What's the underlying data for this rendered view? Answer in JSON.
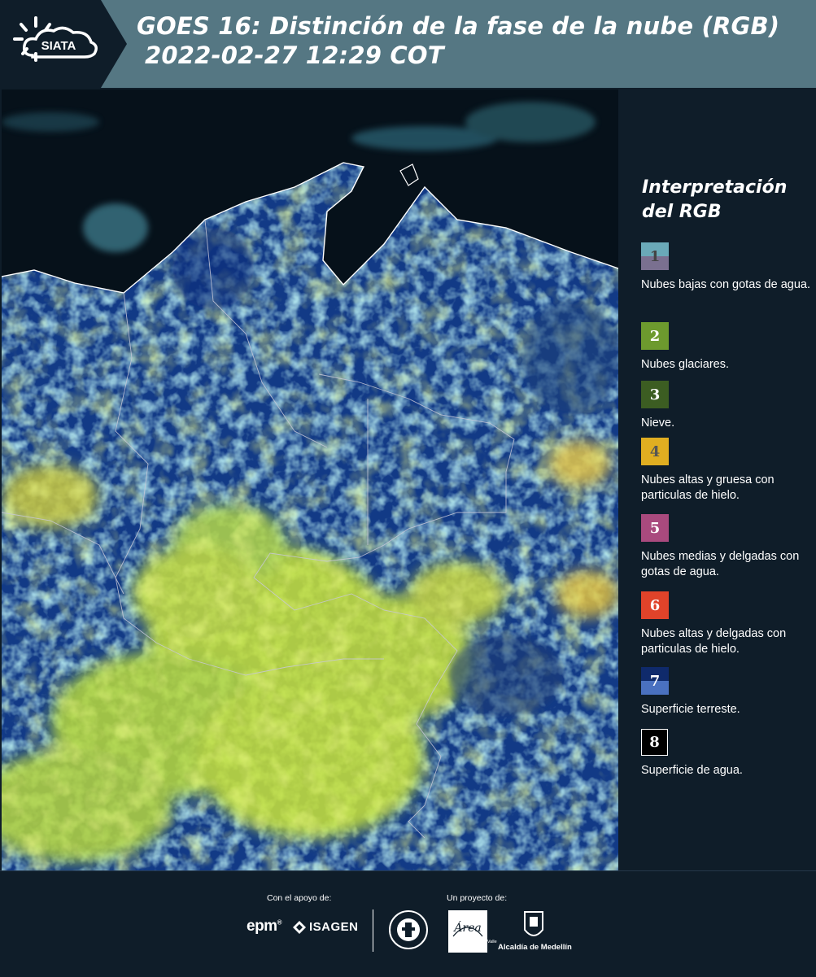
{
  "header": {
    "logo_text": "SIATA",
    "title_line1": "GOES 16: Distinción de la fase de la nube (RGB)",
    "title_line2": "2022-02-27 12:29 COT",
    "background_color": "#557783"
  },
  "legend": {
    "title": "Interpretación del RGB",
    "items": [
      {
        "number": "1",
        "description": "Nubes bajas con gotas de agua.",
        "color_top": "#6aa9b8",
        "color_bottom": "#7a7090",
        "number_color": "#444"
      },
      {
        "number": "2",
        "description": "Nubes glaciares.",
        "color_top": "#6d9a2e",
        "color_bottom": "#6d9a2e",
        "number_color": "#fff"
      },
      {
        "number": "3",
        "description": "Nieve.",
        "color_top": "#3c5d22",
        "color_bottom": "#3c5d22",
        "number_color": "#fff"
      },
      {
        "number": "4",
        "description": "Nubes altas y gruesa con particulas de hielo.",
        "color_top": "#e0ae21",
        "color_bottom": "#e0ae21",
        "number_color": "#555"
      },
      {
        "number": "5",
        "description": "Nubes medias y delgadas con gotas de agua.",
        "color_top": "#a94a7e",
        "color_bottom": "#a94a7e",
        "number_color": "#fff"
      },
      {
        "number": "6",
        "description": "Nubes altas y delgadas con particulas de hielo.",
        "color_top": "#e0432a",
        "color_bottom": "#e0432a",
        "number_color": "#fff"
      },
      {
        "number": "7",
        "description": "Superficie terreste.",
        "color_top": "#0f2a6b",
        "color_bottom": "#4a71c0",
        "number_color": "#fff"
      },
      {
        "number": "8",
        "description": "Superficie de agua.",
        "color_top": "#000000",
        "color_bottom": "#000000",
        "number_color": "#fff"
      }
    ]
  },
  "footer": {
    "support_label": "Con el apoyo de:",
    "project_label": "Un proyecto de:",
    "sponsor1": "epm",
    "sponsor2": "ISAGEN",
    "area_logo": "Área",
    "area_subtitle": "METROPOLITANA Valle de Aburrá",
    "alcaldia": "Alcaldía de Medellín"
  }
}
